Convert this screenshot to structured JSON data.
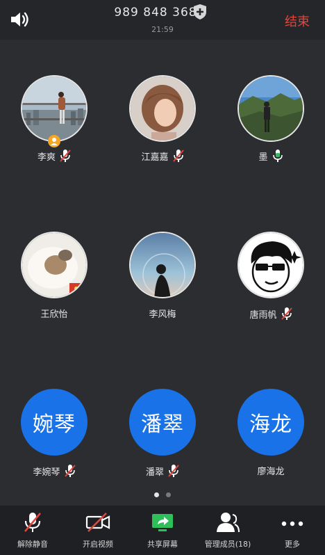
{
  "header": {
    "meeting_id": "989 848 368",
    "time": "21:59",
    "end_label": "结束"
  },
  "participants": [
    {
      "name": "李爽",
      "mic": "muted",
      "host": true,
      "avatar": "photo-city-view"
    },
    {
      "name": "江嘉嘉",
      "mic": "muted",
      "avatar": "photo-portrait"
    },
    {
      "name": "墨",
      "mic": "active",
      "avatar": "photo-mountain"
    },
    {
      "name": "王欣怡",
      "mic": "none",
      "avatar": "photo-cat-toy"
    },
    {
      "name": "李风梅",
      "mic": "none",
      "avatar": "photo-silhouette"
    },
    {
      "name": "唐雨帆",
      "mic": "muted",
      "avatar": "cartoon-sunglasses"
    },
    {
      "name": "李婉琴",
      "mic": "muted",
      "avatar_text": "婉琴"
    },
    {
      "name": "潘翠",
      "mic": "muted",
      "avatar_text": "潘翠"
    },
    {
      "name": "廖海龙",
      "mic": "none",
      "avatar_text": "海龙"
    }
  ],
  "pagination": {
    "current": 1,
    "total": 2
  },
  "toolbar": {
    "unmute": "解除静音",
    "start_video": "开启视频",
    "share_screen": "共享屏幕",
    "manage_members": "管理成员(18)",
    "more": "更多"
  },
  "colors": {
    "background": "#2b2d31",
    "accent_blue": "#1a72e8",
    "end_red": "#e0463e",
    "mute_red": "#e0463e",
    "mic_green": "#2fbf5a",
    "share_green": "#2fbf5a",
    "host_badge": "#f5a623"
  }
}
